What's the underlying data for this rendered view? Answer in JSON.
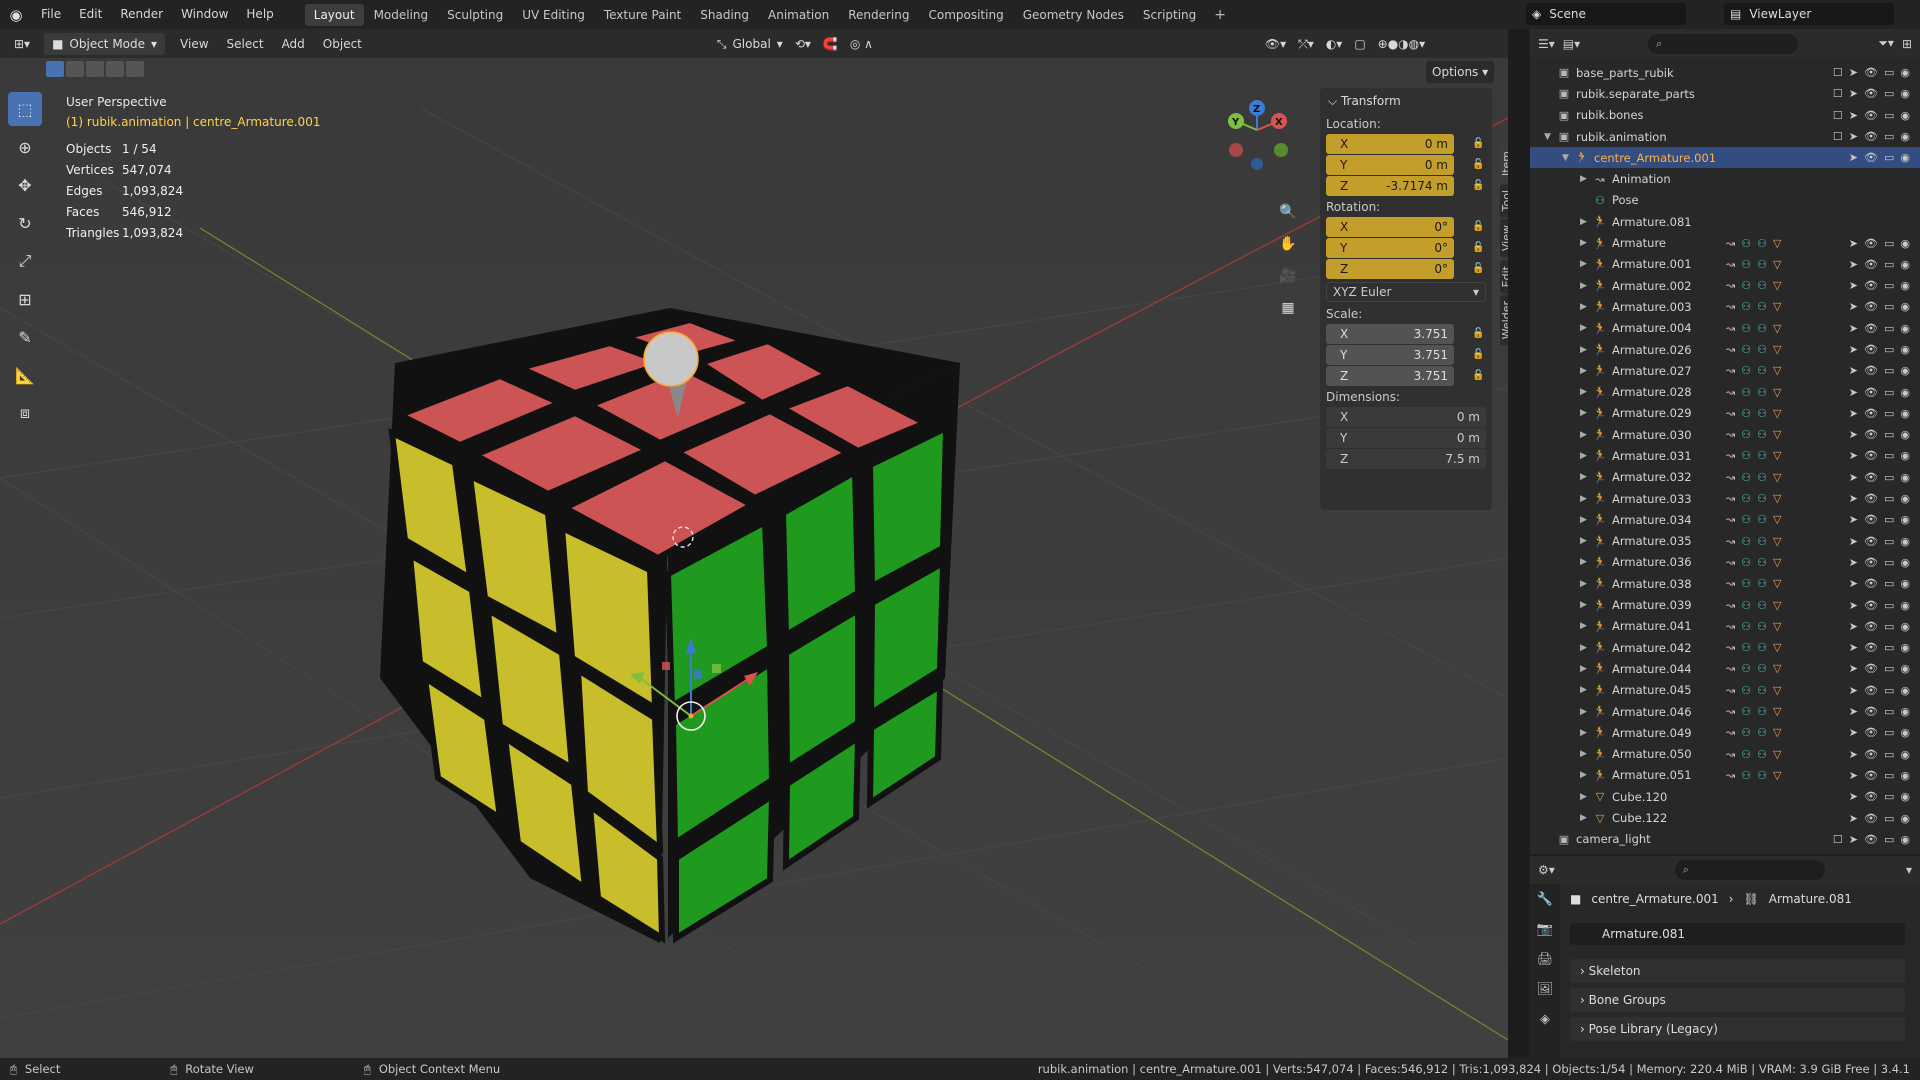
{
  "menu": [
    "File",
    "Edit",
    "Render",
    "Window",
    "Help"
  ],
  "workspaces": [
    "Layout",
    "Modeling",
    "Sculpting",
    "UV Editing",
    "Texture Paint",
    "Shading",
    "Animation",
    "Rendering",
    "Compositing",
    "Geometry Nodes",
    "Scripting"
  ],
  "active_workspace": "Layout",
  "add_tab": "+",
  "scene": "Scene",
  "view_layer": "ViewLayer",
  "viewport_header": {
    "mode": "Object Mode",
    "menus": [
      "View",
      "Select",
      "Add",
      "Object"
    ],
    "orientation": "Global",
    "options": "Options"
  },
  "viewport": {
    "perspective": "User Perspective",
    "selection": "(1) rubik.animation | centre_Armature.001",
    "stats": [
      {
        "k": "Objects",
        "v": "1 / 54"
      },
      {
        "k": "Vertices",
        "v": "547,074"
      },
      {
        "k": "Edges",
        "v": "1,093,824"
      },
      {
        "k": "Faces",
        "v": "546,912"
      },
      {
        "k": "Triangles",
        "v": "1,093,824"
      }
    ],
    "gizmo_axes": {
      "x": "X",
      "y": "Y",
      "z": "Z"
    }
  },
  "npanel": {
    "title": "Transform",
    "location_label": "Location:",
    "location": [
      {
        "a": "X",
        "v": "0 m"
      },
      {
        "a": "Y",
        "v": "0 m"
      },
      {
        "a": "Z",
        "v": "-3.7174 m"
      }
    ],
    "rotation_label": "Rotation:",
    "rotation": [
      {
        "a": "X",
        "v": "0°"
      },
      {
        "a": "Y",
        "v": "0°"
      },
      {
        "a": "Z",
        "v": "0°"
      }
    ],
    "rotation_mode": "XYZ Euler",
    "scale_label": "Scale:",
    "scale": [
      {
        "a": "X",
        "v": "3.751"
      },
      {
        "a": "Y",
        "v": "3.751"
      },
      {
        "a": "Z",
        "v": "3.751"
      }
    ],
    "dimensions_label": "Dimensions:",
    "dimensions": [
      {
        "a": "X",
        "v": "0 m"
      },
      {
        "a": "Y",
        "v": "0 m"
      },
      {
        "a": "Z",
        "v": "7.5 m"
      }
    ],
    "tabs": [
      "Item",
      "Tool",
      "View",
      "Edit",
      "Welder"
    ]
  },
  "outliner": {
    "rows": [
      {
        "name": "base_parts_rubik",
        "depth": 0,
        "type": "collection",
        "tri": ""
      },
      {
        "name": "rubik.separate_parts",
        "depth": 0,
        "type": "collection",
        "tri": ""
      },
      {
        "name": "rubik.bones",
        "depth": 0,
        "type": "collection",
        "tri": ""
      },
      {
        "name": "rubik.animation",
        "depth": 0,
        "type": "collection",
        "tri": "▼"
      },
      {
        "name": "centre_Armature.001",
        "depth": 1,
        "type": "armature",
        "tri": "▼",
        "sel": true
      },
      {
        "name": "Animation",
        "depth": 2,
        "type": "anim",
        "tri": "▶"
      },
      {
        "name": "Pose",
        "depth": 2,
        "type": "pose",
        "tri": ""
      },
      {
        "name": "Armature.081",
        "depth": 2,
        "type": "armature",
        "tri": "▶"
      },
      {
        "name": "Armature",
        "depth": 2,
        "type": "armature",
        "tri": "▶"
      },
      {
        "name": "Armature.001",
        "depth": 2,
        "type": "armature",
        "tri": "▶"
      },
      {
        "name": "Armature.002",
        "depth": 2,
        "type": "armature",
        "tri": "▶"
      },
      {
        "name": "Armature.003",
        "depth": 2,
        "type": "armature",
        "tri": "▶"
      },
      {
        "name": "Armature.004",
        "depth": 2,
        "type": "armature",
        "tri": "▶"
      },
      {
        "name": "Armature.026",
        "depth": 2,
        "type": "armature",
        "tri": "▶"
      },
      {
        "name": "Armature.027",
        "depth": 2,
        "type": "armature",
        "tri": "▶"
      },
      {
        "name": "Armature.028",
        "depth": 2,
        "type": "armature",
        "tri": "▶"
      },
      {
        "name": "Armature.029",
        "depth": 2,
        "type": "armature",
        "tri": "▶"
      },
      {
        "name": "Armature.030",
        "depth": 2,
        "type": "armature",
        "tri": "▶"
      },
      {
        "name": "Armature.031",
        "depth": 2,
        "type": "armature",
        "tri": "▶"
      },
      {
        "name": "Armature.032",
        "depth": 2,
        "type": "armature",
        "tri": "▶"
      },
      {
        "name": "Armature.033",
        "depth": 2,
        "type": "armature",
        "tri": "▶"
      },
      {
        "name": "Armature.034",
        "depth": 2,
        "type": "armature",
        "tri": "▶"
      },
      {
        "name": "Armature.035",
        "depth": 2,
        "type": "armature",
        "tri": "▶"
      },
      {
        "name": "Armature.036",
        "depth": 2,
        "type": "armature",
        "tri": "▶"
      },
      {
        "name": "Armature.038",
        "depth": 2,
        "type": "armature",
        "tri": "▶"
      },
      {
        "name": "Armature.039",
        "depth": 2,
        "type": "armature",
        "tri": "▶"
      },
      {
        "name": "Armature.041",
        "depth": 2,
        "type": "armature",
        "tri": "▶"
      },
      {
        "name": "Armature.042",
        "depth": 2,
        "type": "armature",
        "tri": "▶"
      },
      {
        "name": "Armature.044",
        "depth": 2,
        "type": "armature",
        "tri": "▶"
      },
      {
        "name": "Armature.045",
        "depth": 2,
        "type": "armature",
        "tri": "▶"
      },
      {
        "name": "Armature.046",
        "depth": 2,
        "type": "armature",
        "tri": "▶"
      },
      {
        "name": "Armature.049",
        "depth": 2,
        "type": "armature",
        "tri": "▶"
      },
      {
        "name": "Armature.050",
        "depth": 2,
        "type": "armature",
        "tri": "▶"
      },
      {
        "name": "Armature.051",
        "depth": 2,
        "type": "armature",
        "tri": "▶"
      },
      {
        "name": "Cube.120",
        "depth": 2,
        "type": "mesh",
        "tri": "▶"
      },
      {
        "name": "Cube.122",
        "depth": 2,
        "type": "mesh",
        "tri": "▶"
      },
      {
        "name": "camera_light",
        "depth": 0,
        "type": "collection",
        "tri": ""
      }
    ]
  },
  "properties": {
    "breadcrumb_object": "centre_Armature.001",
    "breadcrumb_data": "Armature.081",
    "data_name": "Armature.081",
    "panels": [
      "Skeleton",
      "Bone Groups",
      "Pose Library (Legacy)"
    ]
  },
  "statusbar": {
    "left": [
      "Select",
      "Rotate View",
      "Object Context Menu"
    ],
    "right": "rubik.animation | centre_Armature.001 | Verts:547,074 | Faces:546,912 | Tris:1,093,824 | Objects:1/54 | Memory: 220.4 MiB | VRAM: 3.9 GiB Free | 3.4.1"
  },
  "colors": {
    "accent": "#4772b3",
    "keyframe": "#c8a22b",
    "cube_red": "#cc5454",
    "cube_yellow": "#c8bd2a",
    "cube_green": "#1f9a1f",
    "grid_red": "#a13a3a",
    "grid_green": "#6a8a2a"
  }
}
